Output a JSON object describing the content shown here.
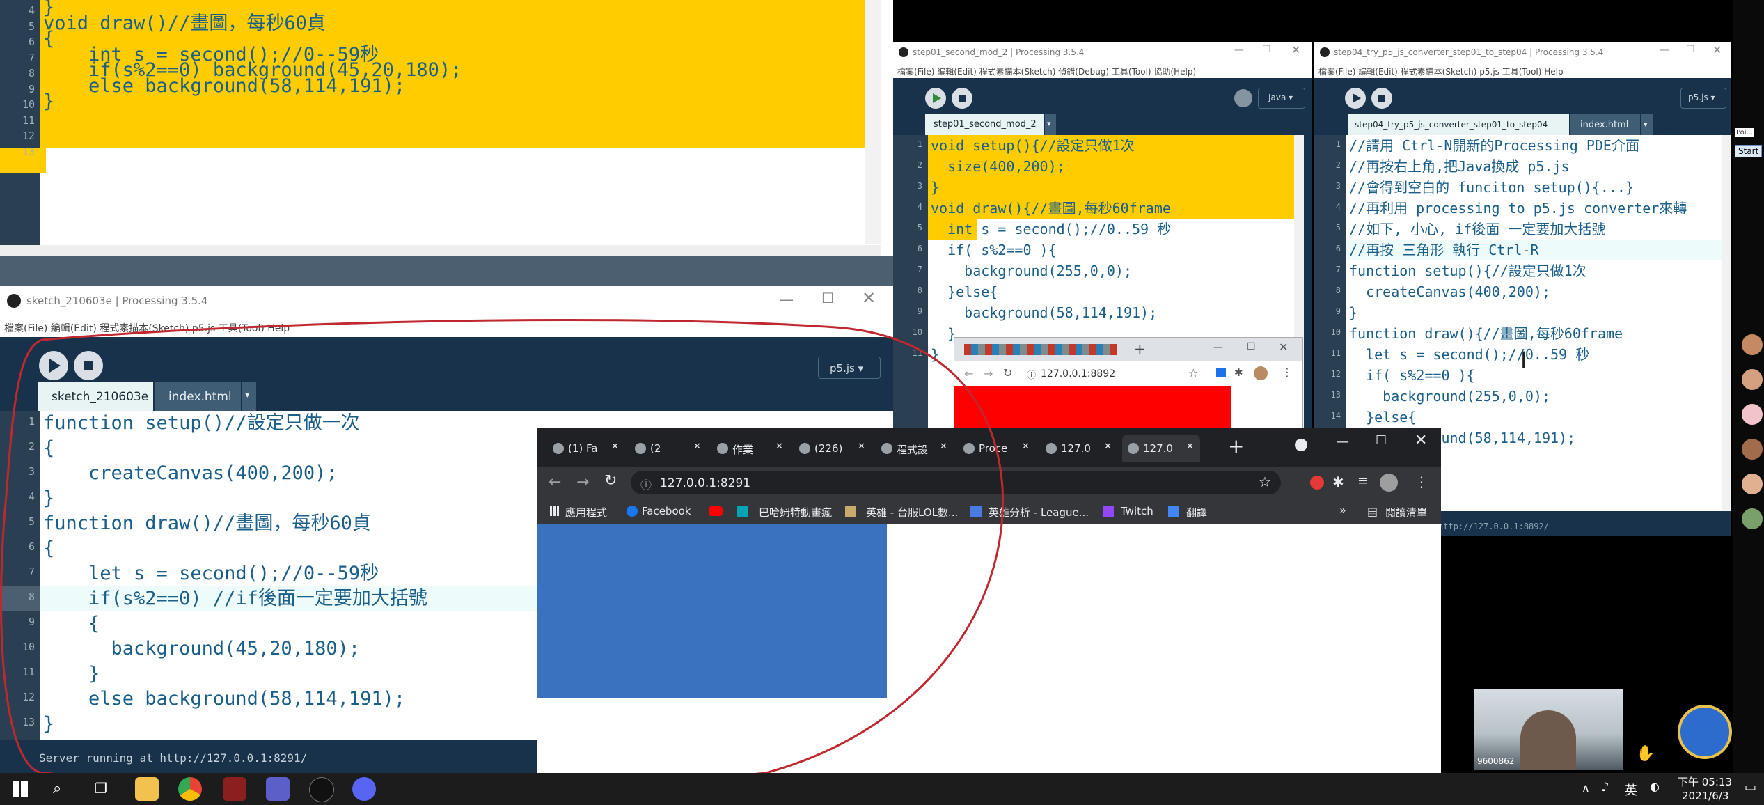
{
  "top_editor": {
    "lines": [
      {
        "n": "4",
        "text": "}"
      },
      {
        "n": "5",
        "text": "void draw()//畫圖，每秒60貞"
      },
      {
        "n": "6",
        "text": "{"
      },
      {
        "n": "7",
        "text": "    int s = second();//0--59秒"
      },
      {
        "n": "8",
        "text": "    if(s%2==0) background(45,20,180);"
      },
      {
        "n": "9",
        "text": "    else background(58,114,191);"
      },
      {
        "n": "10",
        "text": "}"
      },
      {
        "n": "11",
        "text": ""
      },
      {
        "n": "12",
        "text": ""
      },
      {
        "n": "13",
        "text": ""
      }
    ]
  },
  "bottom_ide": {
    "title": "sketch_210603e | Processing 3.5.4",
    "menu": "檔案(File)  編輯(Edit)  程式素描本(Sketch)  p5.js  工具(Tool)  Help",
    "mode": "p5.js ▾",
    "tabs": [
      "sketch_210603e",
      "index.html",
      "▾"
    ],
    "lines": [
      {
        "n": "1",
        "text": "function setup()//設定只做一次"
      },
      {
        "n": "2",
        "text": "{"
      },
      {
        "n": "3",
        "text": "    createCanvas(400,200);"
      },
      {
        "n": "4",
        "text": "}"
      },
      {
        "n": "5",
        "text": "function draw()//畫圖，每秒60貞"
      },
      {
        "n": "6",
        "text": "{"
      },
      {
        "n": "7",
        "text": "    let s = second();//0--59秒"
      },
      {
        "n": "8",
        "text": "    if(s%2==0) //if後面一定要加大括號"
      },
      {
        "n": "9",
        "text": "    {"
      },
      {
        "n": "10",
        "text": "      background(45,20,180);"
      },
      {
        "n": "11",
        "text": "    }"
      },
      {
        "n": "12",
        "text": "    else background(58,114,191);"
      },
      {
        "n": "13",
        "text": "}"
      }
    ],
    "console": "Server running at http://127.0.0.1:8291/"
  },
  "mid_ide": {
    "title": "step01_second_mod_2 | Processing 3.5.4",
    "menu": "檔案(File)  編輯(Edit)  程式素描本(Sketch)  偵錯(Debug)  工具(Tool)  協助(Help)",
    "mode": "Java ▾",
    "tab": "step01_second_mod_2",
    "lines": [
      {
        "n": "1",
        "text": "void setup(){//設定只做1次"
      },
      {
        "n": "2",
        "text": "  size(400,200);"
      },
      {
        "n": "3",
        "text": "}"
      },
      {
        "n": "4",
        "text": "void draw(){//畫圖,每秒60frame"
      },
      {
        "n": "5",
        "text": "  int s = second();//0..59 秒"
      },
      {
        "n": "6",
        "text": "  if( s%2==0 ){"
      },
      {
        "n": "7",
        "text": "    background(255,0,0);"
      },
      {
        "n": "8",
        "text": "  }else{"
      },
      {
        "n": "9",
        "text": "    background(58,114,191);"
      },
      {
        "n": "10",
        "text": "  }"
      },
      {
        "n": "11",
        "text": "}"
      }
    ]
  },
  "right_ide": {
    "title": "step04_try_p5_js_converter_step01_to_step04 | Processing 3.5.4",
    "menu": "檔案(File)  編輯(Edit)  程式素描本(Sketch)  p5.js  工具(Tool)  Help",
    "mode": "p5.js ▾",
    "tabs": [
      "step04_try_p5_js_converter_step01_to_step04",
      "index.html",
      "▾"
    ],
    "lines": [
      {
        "n": "1",
        "text": "//請用 Ctrl-N開新的Processing PDE介面"
      },
      {
        "n": "2",
        "text": "//再按右上角,把Java換成 p5.js"
      },
      {
        "n": "3",
        "text": "//會得到空白的 funciton setup(){...}"
      },
      {
        "n": "4",
        "text": "//再利用 processing to p5.js converter來轉"
      },
      {
        "n": "5",
        "text": "//如下, 小心, if後面 一定要加大括號"
      },
      {
        "n": "6",
        "text": "//再按 三角形 執行 Ctrl-R"
      },
      {
        "n": "7",
        "text": "function setup(){//設定只做1次"
      },
      {
        "n": "8",
        "text": "  createCanvas(400,200);"
      },
      {
        "n": "9",
        "text": "}"
      },
      {
        "n": "10",
        "text": "function draw(){//畫圖,每秒60frame"
      },
      {
        "n": "11",
        "text": "  let s = second();//0..59 秒"
      },
      {
        "n": "12",
        "text": "  if( s%2==0 ){"
      },
      {
        "n": "13",
        "text": "    background(255,0,0);"
      },
      {
        "n": "14",
        "text": "  }else{"
      },
      {
        "n": "15",
        "text": "    background(58,114,191);"
      }
    ],
    "status": "http://127.0.0.1:8892/"
  },
  "small_browser": {
    "url": "127.0.0.1:8892"
  },
  "chrome": {
    "tabs": [
      "(1) Fa",
      "(2",
      "作業",
      "(226)",
      "程式設",
      "Proce",
      "127.0",
      "127.0"
    ],
    "url": "127.0.0.1:8291",
    "bookmarks": [
      "應用程式",
      "Facebook",
      "",
      "巴哈姆特動畫瘋",
      "英雄 - 台服LOL數...",
      "英雄分析 - League...",
      "Twitch",
      "翻譯"
    ],
    "reading_list": "閱讀清單",
    "canvas_color": "#3a72bf"
  },
  "zoom": {
    "start_label": "Start",
    "tooltip": "Poi..."
  },
  "webcam": {
    "label": "9600862"
  },
  "taskbar": {
    "ime": "英",
    "time": "下午 05:13",
    "date": "2021/6/3"
  },
  "colors": {
    "ide_bg": "#17324a",
    "highlight": "#ffcc00",
    "keyword": "#e2661a",
    "function": "#006699",
    "comment": "#666666",
    "red_canvas": "#ff0000"
  }
}
